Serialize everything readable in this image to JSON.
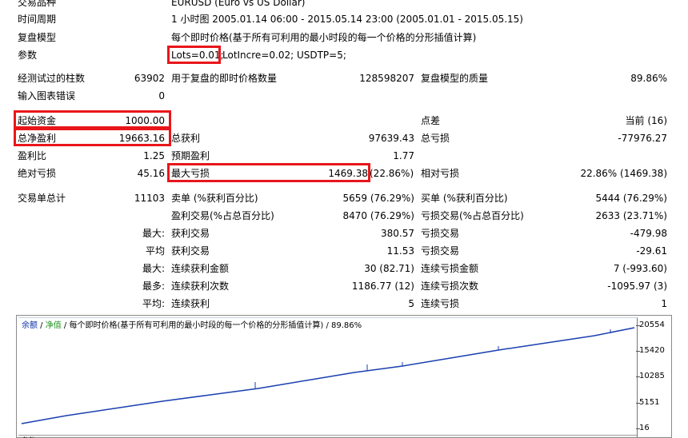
{
  "settings": {
    "symbol_label": "交易品种",
    "symbol_value": "EURUSD (Euro vs US Dollar)",
    "period_label": "时间周期",
    "period_value": "1 小时图 2005.01.14 06:00 - 2015.05.14 23:00 (2005.01.01 - 2015.05.15)",
    "model_label": "复盘模型",
    "model_value": "每个即时价格(基于所有可利用的最小时段的每一个价格的分形插值计算)",
    "params_label": "参数",
    "params_lots": "Lots=0.01;",
    "params_rest": "LotIncre=0.02; USDTP=5;"
  },
  "summary": {
    "bars_label": "经测试过的柱数",
    "bars_value": "63902",
    "ticks_label": "用于复盘的即时价格数量",
    "ticks_value": "128598207",
    "quality_label": "复盘模型的质量",
    "quality_value": "89.86%",
    "errors_label": "输入图表错误",
    "errors_value": "0"
  },
  "stats": {
    "deposit_label": "起始资金",
    "deposit_value": "1000.00",
    "spread_label": "点差",
    "spread_value": "当前 (16)",
    "net_label": "总净盈利",
    "net_value": "19663.16",
    "gross_profit_label": "总获利",
    "gross_profit_value": "97639.43",
    "gross_loss_label": "总亏损",
    "gross_loss_value": "-77976.27",
    "pf_label": "盈利比",
    "pf_value": "1.25",
    "payoff_label": "预期盈利",
    "payoff_value": "1.77",
    "abs_dd_label": "绝对亏损",
    "abs_dd_value": "45.16",
    "max_dd_label": "最大亏损",
    "max_dd_value": "1469.38",
    "max_dd_pct": "(22.86%)",
    "rel_dd_label": "相对亏损",
    "rel_dd_value": "22.86% (1469.38)"
  },
  "trades": {
    "total_label": "交易单总计",
    "total_value": "11103",
    "short_label": "卖单 (%获利百分比)",
    "short_value": "5659 (76.29%)",
    "long_label": "买单 (%获利百分比)",
    "long_value": "5444 (76.29%)",
    "win_label": "盈利交易(%占总百分比)",
    "win_value": "8470 (76.29%)",
    "loss_label": "亏损交易(%占总百分比)",
    "loss_value": "2633 (23.71%)",
    "rows": [
      {
        "prefix": "最大:",
        "l_label": "获利交易",
        "l_value": "380.57",
        "r_label": "亏损交易",
        "r_value": "-479.98"
      },
      {
        "prefix": "平均",
        "l_label": "获利交易",
        "l_value": "11.53",
        "r_label": "亏损交易",
        "r_value": "-29.61"
      },
      {
        "prefix": "最大:",
        "l_label": "连续获利金额",
        "l_value": "30 (82.71)",
        "r_label": "连续亏损金额",
        "r_value": "7 (-993.60)"
      },
      {
        "prefix": "最多:",
        "l_label": "连续获利次数",
        "l_value": "1186.77 (12)",
        "r_label": "连续亏损次数",
        "r_value": "-1095.97 (3)"
      },
      {
        "prefix": "平均:",
        "l_label": "连续获利",
        "l_value": "5",
        "r_label": "连续亏损",
        "r_value": "1"
      }
    ]
  },
  "chart": {
    "header_balance": "余额",
    "header_equity": "净值",
    "header_text": "/ 每个即时价格(基于所有可利用的最小时段的每一个价格的分形插值计算) / 89.86%",
    "y_labels": [
      "20554",
      "15420",
      "10285",
      "5151",
      "16"
    ],
    "footer_label": "条数",
    "line_color": "#1a3fb0"
  }
}
